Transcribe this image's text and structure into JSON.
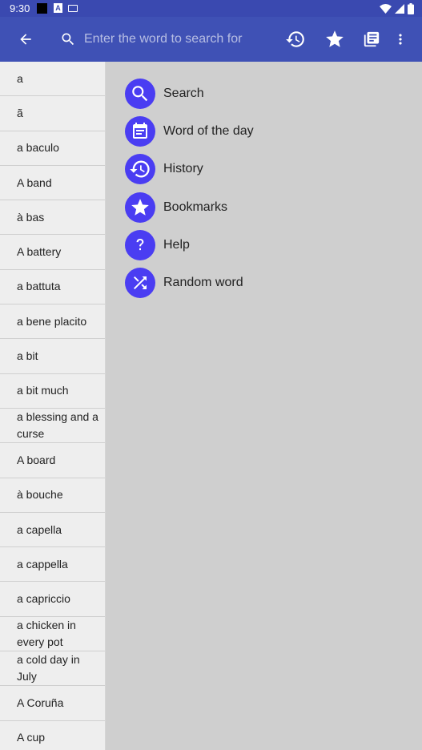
{
  "status_bar": {
    "time": "9:30",
    "badge_letter": "A"
  },
  "app_bar": {
    "search_placeholder": "Enter the word to search for",
    "icons": [
      "back-arrow-icon",
      "search-icon",
      "history-icon",
      "star-icon",
      "library-books-icon",
      "more-vert-icon"
    ]
  },
  "word_list": [
    "a",
    "ã",
    "a baculo",
    "A band",
    "à bas",
    "A battery",
    "a battuta",
    "a bene placito",
    "a bit",
    "a bit much",
    "a blessing and a curse",
    "A board",
    "à bouche",
    "a capella",
    "a cappella",
    "a capriccio",
    "a chicken in every pot",
    "a cold day in July",
    "A Coruña",
    "A cup"
  ],
  "menu": [
    {
      "label": "Search",
      "icon": "search-icon"
    },
    {
      "label": "Word of the day",
      "icon": "calendar-icon"
    },
    {
      "label": "History",
      "icon": "history-icon"
    },
    {
      "label": "Bookmarks",
      "icon": "star-icon"
    },
    {
      "label": "Help",
      "icon": "help-icon"
    },
    {
      "label": "Random word",
      "icon": "shuffle-icon"
    }
  ],
  "colors": {
    "status_bar": "#3a49b0",
    "app_bar": "#3f51b5",
    "accent": "#4a3df2",
    "background": "#cfcfcf",
    "list_background": "#eeeeee"
  }
}
